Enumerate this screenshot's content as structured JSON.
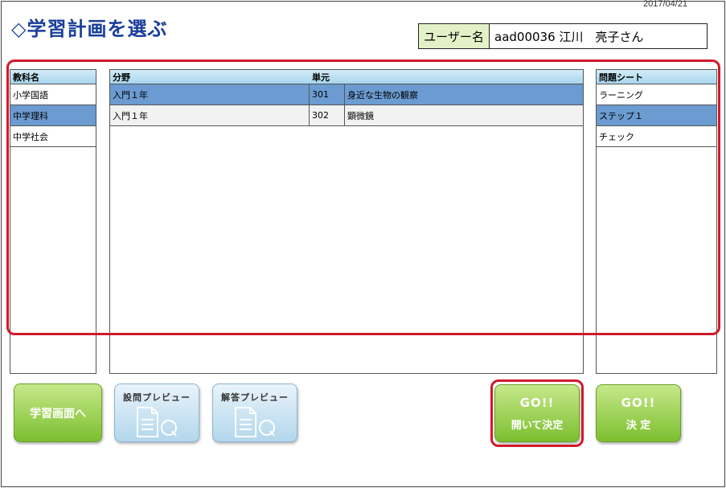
{
  "header": {
    "date": "2017/04/21",
    "title": "◇学習計画を選ぶ",
    "user_label": "ユーザー名",
    "user_value": "aad00036 江川　亮子さん"
  },
  "subject_panel": {
    "header": "教科名",
    "items": [
      "小学国語",
      "中学理科",
      "中学社会"
    ],
    "selected_index": 1
  },
  "field_panel": {
    "header_field": "分野",
    "header_unit": "単元",
    "rows": [
      {
        "field": "入門１年",
        "code": "301",
        "unit": "身近な生物の観察"
      },
      {
        "field": "入門１年",
        "code": "302",
        "unit": "顕微鏡"
      }
    ],
    "selected_index": 0
  },
  "sheet_panel": {
    "header": "問題シート",
    "items": [
      "ラーニング",
      "ステップ１",
      "チェック"
    ],
    "selected_index": 1
  },
  "buttons": {
    "study": "学習画面へ",
    "question_preview": "設問プレビュー",
    "answer_preview": "解答プレビュー",
    "go_open": {
      "top": "GO!!",
      "bottom": "開いて決定"
    },
    "go_decide": {
      "top": "GO!!",
      "bottom": "決 定"
    }
  },
  "colors": {
    "title": "#1a3e9a",
    "selected_row": "#6b9bd1",
    "highlight_frame": "#d11a2a",
    "green_button": "#7cbf2f"
  }
}
